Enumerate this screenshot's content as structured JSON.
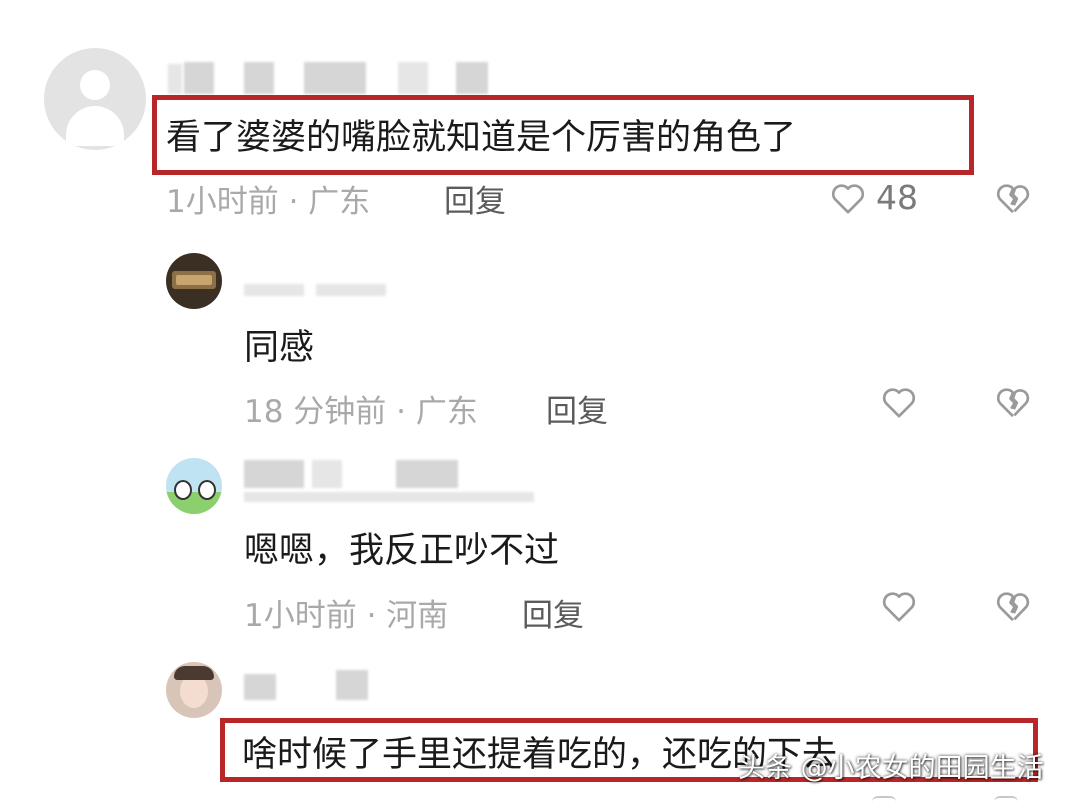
{
  "comments": [
    {
      "text": "看了婆婆的嘴脸就知道是个厉害的角色了",
      "meta": "1小时前 · 广东",
      "reply_label": "回复",
      "like_count": "48"
    },
    {
      "text": "同感",
      "meta": "18 分钟前 · 广东",
      "reply_label": "回复"
    },
    {
      "text": "嗯嗯，我反正吵不过",
      "meta": "1小时前 · 河南",
      "reply_label": "回复"
    },
    {
      "text": "啥时候了手里还提着吃的，还吃的下去",
      "meta": "",
      "reply_label": ""
    }
  ],
  "watermark": "头条 @小农女的田园生活",
  "colors": {
    "highlight": "#b8262a",
    "meta_text": "#a9a9a9",
    "body_text": "#1a1a1a"
  },
  "icons": {
    "like": "heart-outline-icon",
    "dislike": "broken-heart-icon",
    "avatar_default": "user-silhouette-icon"
  }
}
